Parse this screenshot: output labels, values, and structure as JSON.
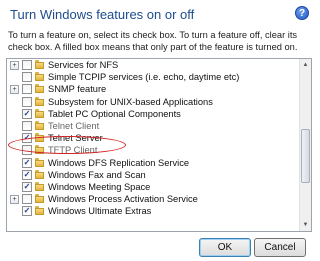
{
  "dialog": {
    "title": "Turn Windows features on or off",
    "help_glyph": "?",
    "description": "To turn a feature on, select its check box. To turn a feature off, clear its check box. A filled box means that only part of the feature is turned on."
  },
  "features": [
    {
      "label": "Services for NFS",
      "expandable": true,
      "expand_glyph": "+",
      "checked": false,
      "check_glyph": ""
    },
    {
      "label": "Simple TCPIP services (i.e. echo, daytime etc)",
      "expandable": false,
      "expand_glyph": "",
      "checked": false,
      "check_glyph": ""
    },
    {
      "label": "SNMP feature",
      "expandable": true,
      "expand_glyph": "+",
      "checked": false,
      "check_glyph": ""
    },
    {
      "label": "Subsystem for UNIX-based Applications",
      "expandable": false,
      "expand_glyph": "",
      "checked": false,
      "check_glyph": ""
    },
    {
      "label": "Tablet PC Optional Components",
      "expandable": false,
      "expand_glyph": "",
      "checked": true,
      "check_glyph": "✓"
    },
    {
      "label": "Telnet Client",
      "expandable": false,
      "expand_glyph": "",
      "checked": false,
      "check_glyph": ""
    },
    {
      "label": "Telnet Server",
      "expandable": false,
      "expand_glyph": "",
      "checked": true,
      "check_glyph": "✓"
    },
    {
      "label": "TFTP Client",
      "expandable": false,
      "expand_glyph": "",
      "checked": false,
      "check_glyph": ""
    },
    {
      "label": "Windows DFS Replication Service",
      "expandable": false,
      "expand_glyph": "",
      "checked": true,
      "check_glyph": "✓"
    },
    {
      "label": "Windows Fax and Scan",
      "expandable": false,
      "expand_glyph": "",
      "checked": true,
      "check_glyph": "✓"
    },
    {
      "label": "Windows Meeting Space",
      "expandable": false,
      "expand_glyph": "",
      "checked": true,
      "check_glyph": "✓"
    },
    {
      "label": "Windows Process Activation Service",
      "expandable": true,
      "expand_glyph": "+",
      "checked": false,
      "check_glyph": ""
    },
    {
      "label": "Windows Ultimate Extras",
      "expandable": false,
      "expand_glyph": "",
      "checked": true,
      "check_glyph": "✓"
    }
  ],
  "scrollbar": {
    "up_glyph": "▲",
    "down_glyph": "▼"
  },
  "buttons": {
    "ok_label": "OK",
    "cancel_label": "Cancel"
  },
  "colors": {
    "title": "#1e4d8f",
    "annotation": "#d22424"
  }
}
